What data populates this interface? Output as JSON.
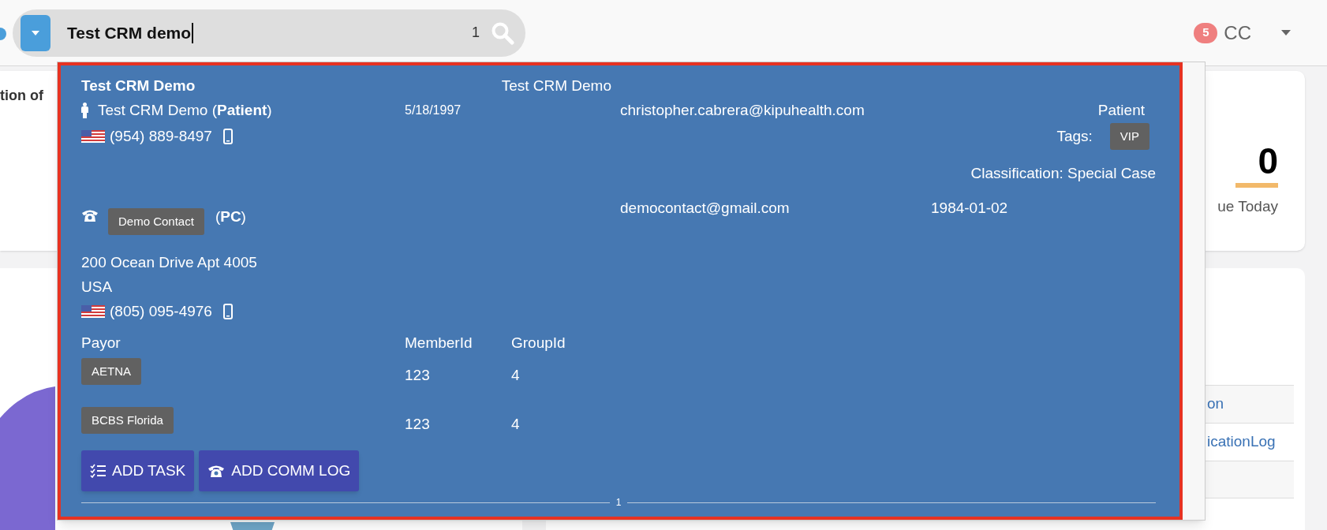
{
  "search": {
    "value": "Test CRM demo",
    "count": "1"
  },
  "user": {
    "notifications": "5",
    "initials": "CC"
  },
  "background": {
    "card_title": "tion of",
    "due_count": "0",
    "due_label": "ue Today",
    "links": [
      "on",
      "icationLog"
    ]
  },
  "result": {
    "name": "Test CRM Demo",
    "display_name": "Test CRM Demo",
    "person": "Test CRM Demo (**Patient**)",
    "dob": "5/18/1997",
    "email": "christopher.cabrera@kipuhealth.com",
    "type": "Patient",
    "phone": "(954) 889-8497",
    "tags_label": "Tags:",
    "tags": [
      "VIP"
    ],
    "classification": "Classification: Special Case",
    "contact": {
      "name": "Demo Contact",
      "relation": "(**PC**)",
      "email": "democontact@gmail.com",
      "dob": "1984-01-02",
      "address": [
        "200 Ocean Drive Apt 4005",
        "USA"
      ],
      "phone": "(805) 095-4976"
    },
    "insurance": {
      "columns": [
        "Payor",
        "MemberId",
        "GroupId"
      ],
      "rows": [
        {
          "payor": "AETNA",
          "member_id": "123",
          "group_id": "4"
        },
        {
          "payor": "BCBS Florida",
          "member_id": "123",
          "group_id": "4"
        }
      ]
    },
    "actions": [
      {
        "label": "ADD TASK",
        "kind": "task"
      },
      {
        "label": "ADD COMM LOG",
        "kind": "phone"
      }
    ],
    "page": "1"
  }
}
